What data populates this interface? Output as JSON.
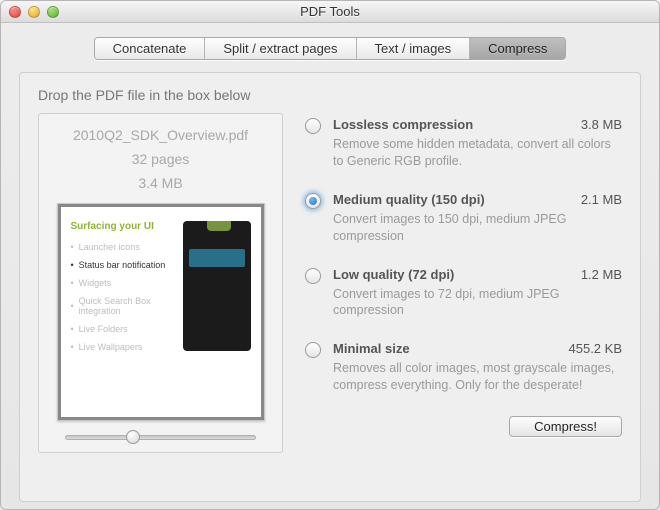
{
  "window": {
    "title": "PDF Tools"
  },
  "tabs": {
    "concatenate": "Concatenate",
    "split": "Split / extract pages",
    "text": "Text / images",
    "compress": "Compress"
  },
  "panel": {
    "hint": "Drop the PDF file in the box below",
    "file": {
      "name": "2010Q2_SDK_Overview.pdf",
      "pages": "32 pages",
      "size": "3.4 MB"
    },
    "thumb": {
      "title": "Surfacing your UI",
      "items": [
        "Launcher icons",
        "Status bar notification",
        "Widgets",
        "Quick Search Box integration",
        "Live Folders",
        "Live Wallpapers"
      ]
    }
  },
  "options": {
    "lossless": {
      "title": "Lossless compression",
      "size": "3.8 MB",
      "desc": "Remove some hidden metadata, convert all colors to Generic RGB profile."
    },
    "medium": {
      "title": "Medium quality (150 dpi)",
      "size": "2.1 MB",
      "desc": "Convert images to 150 dpi, medium JPEG compression"
    },
    "low": {
      "title": "Low quality (72 dpi)",
      "size": "1.2 MB",
      "desc": "Convert images to 72 dpi, medium JPEG compression"
    },
    "minimal": {
      "title": "Minimal size",
      "size": "455.2 KB",
      "desc": "Removes all color images, most grayscale images, compress everything. Only for the desperate!"
    }
  },
  "actions": {
    "compress": "Compress!"
  }
}
